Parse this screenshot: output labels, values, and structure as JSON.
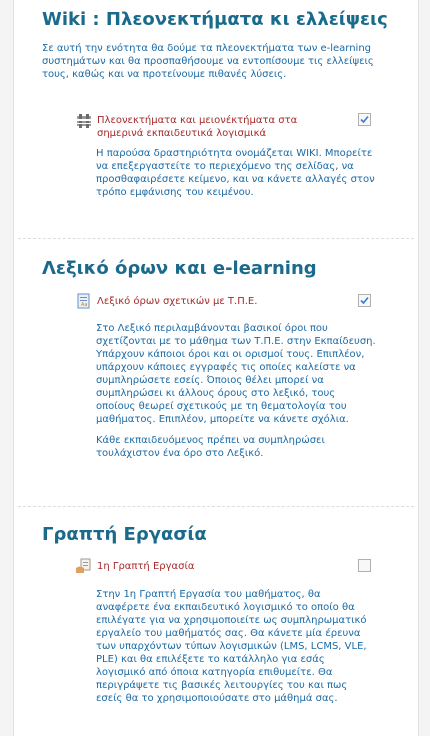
{
  "sections": [
    {
      "title": "Wiki : Πλεονεκτήματα κι ελλείψεις",
      "summary": "Σε αυτή την ενότητα θα δούμε τα πλεονεκτήματα των e-learning συστημάτων και θα προσπαθήσουμε να εντοπίσουμε τις ελλείψεις τους, καθώς και να προτείνουμε πιθανές λύσεις.",
      "activity": {
        "icon": "wiki-icon",
        "link": "Πλεονεκτήματα και μειονέκτήματα στα σημερινά εκπαιδευτικά λογισμικά",
        "completed": true,
        "description": [
          "Η παρούσα δραστηριότητα ονομάζεται WIKI. Μπορείτε να επεξεργαστείτε το περιεχόμενο της σελίδας, να προσθαφαιρέσετε κείμενο, και να κάνετε αλλαγές στον τρόπο εμφάνισης του κειμένου."
        ]
      }
    },
    {
      "title": "Λεξικό όρων και e-learning",
      "summary": "",
      "activity": {
        "icon": "glossary-icon",
        "link": "Λεξικό όρων σχετικών με Τ.Π.Ε.",
        "completed": true,
        "description": [
          "Στο Λεξικό περιλαμβάνονται βασικοί όροι που σχετίζονται με το μάθημα των Τ.Π.Ε. στην Εκπαίδευση. Υπάρχουν κάποιοι όροι και οι ορισμοί τους. Επιπλέον, υπάρχουν κάποιες εγγραφές τις οποίες καλείστε να συμπληρώσετε εσείς. Όποιος θέλει μπορεί να συμπληρώσει κι άλλους όρους στο λεξικό, τους οποίους θεωρεί σχετικούς με τη θεματολογία του μαθήματος. Επιπλέον, μπορείτε να κάνετε σχόλια.",
          "Κάθε εκπαιδευόμενος πρέπει να συμπληρώσει τουλάχιστον ένα όρο στο Λεξικό."
        ]
      }
    },
    {
      "title": "Γραπτή Εργασία",
      "summary": "",
      "activity": {
        "icon": "assignment-icon",
        "link": "1η Γραπτή Εργασία",
        "completed": false,
        "description": [
          "Στην 1η Γραπτή Εργασία του μαθήματος, θα αναφέρετε ένα εκπαιδευτικό λογισμικό το οποίο θα επιλέγατε για να χρησιμοποιείτε ως συμπληρωματικό εργαλείο του μαθήματός σας. Θα κάνετε μία έρευνα των υπαρχόντων τύπων λογισμικών (LMS, LCMS, VLE, PLE) και θα επιλέξετε το κατάλληλο για εσάς λογισμικό από όποια κατηγορία επιθυμείτε. Θα περιγράψετε τις βασικές λειτουργίες του και πως εσείς θα το χρησιμοποιούσατε στο μάθημά σας."
        ]
      }
    }
  ],
  "colors": {
    "title": "#1a6a8c",
    "text": "#1a6aa6",
    "link": "#a52a2a",
    "check": "#3a7bd5"
  }
}
